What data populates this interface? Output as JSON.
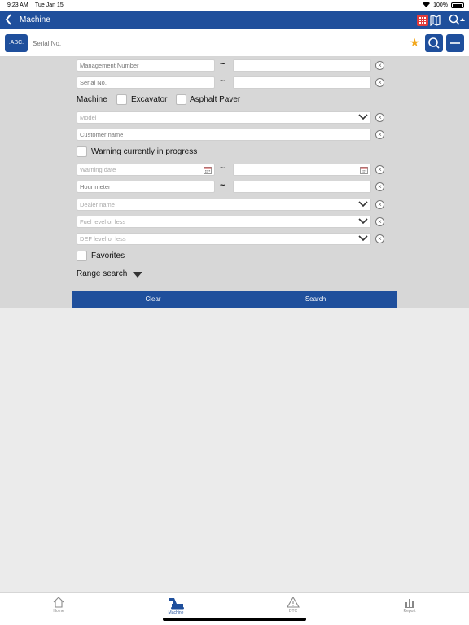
{
  "status": {
    "time": "9:23 AM",
    "date": "Tue Jan 15",
    "battery": "100%"
  },
  "nav": {
    "title": "Machine"
  },
  "search": {
    "mode_label": ".ABC.",
    "placeholder": "Serial No."
  },
  "form": {
    "management_number_placeholder": "Management Number",
    "serial_no_placeholder": "Serial No.",
    "tilde": "~",
    "machine_label": "Machine",
    "machine_types": [
      "Excavator",
      "Asphalt Paver"
    ],
    "model_placeholder": "Model",
    "customer_name_placeholder": "Customer name",
    "warning_label": "Warning currently in progress",
    "warning_date_placeholder": "Warning date",
    "hour_meter_placeholder": "Hour meter",
    "dealer_name_placeholder": "Dealer name",
    "fuel_placeholder": "Fuel level or less",
    "def_placeholder": "DEF level or less",
    "favorites_label": "Favorites",
    "range_search_label": "Range search",
    "clear_label": "Clear",
    "search_label": "Search"
  },
  "tabs": [
    {
      "label": "Home",
      "icon": "home-icon",
      "active": false
    },
    {
      "label": "Machine",
      "icon": "excavator-icon",
      "active": true
    },
    {
      "label": "DTC",
      "icon": "warning-icon",
      "active": false
    },
    {
      "label": "Report",
      "icon": "bar-chart-icon",
      "active": false
    }
  ],
  "colors": {
    "primary": "#1f4f9c",
    "star": "#f2a71b",
    "grid_button": "#e23b3b"
  }
}
